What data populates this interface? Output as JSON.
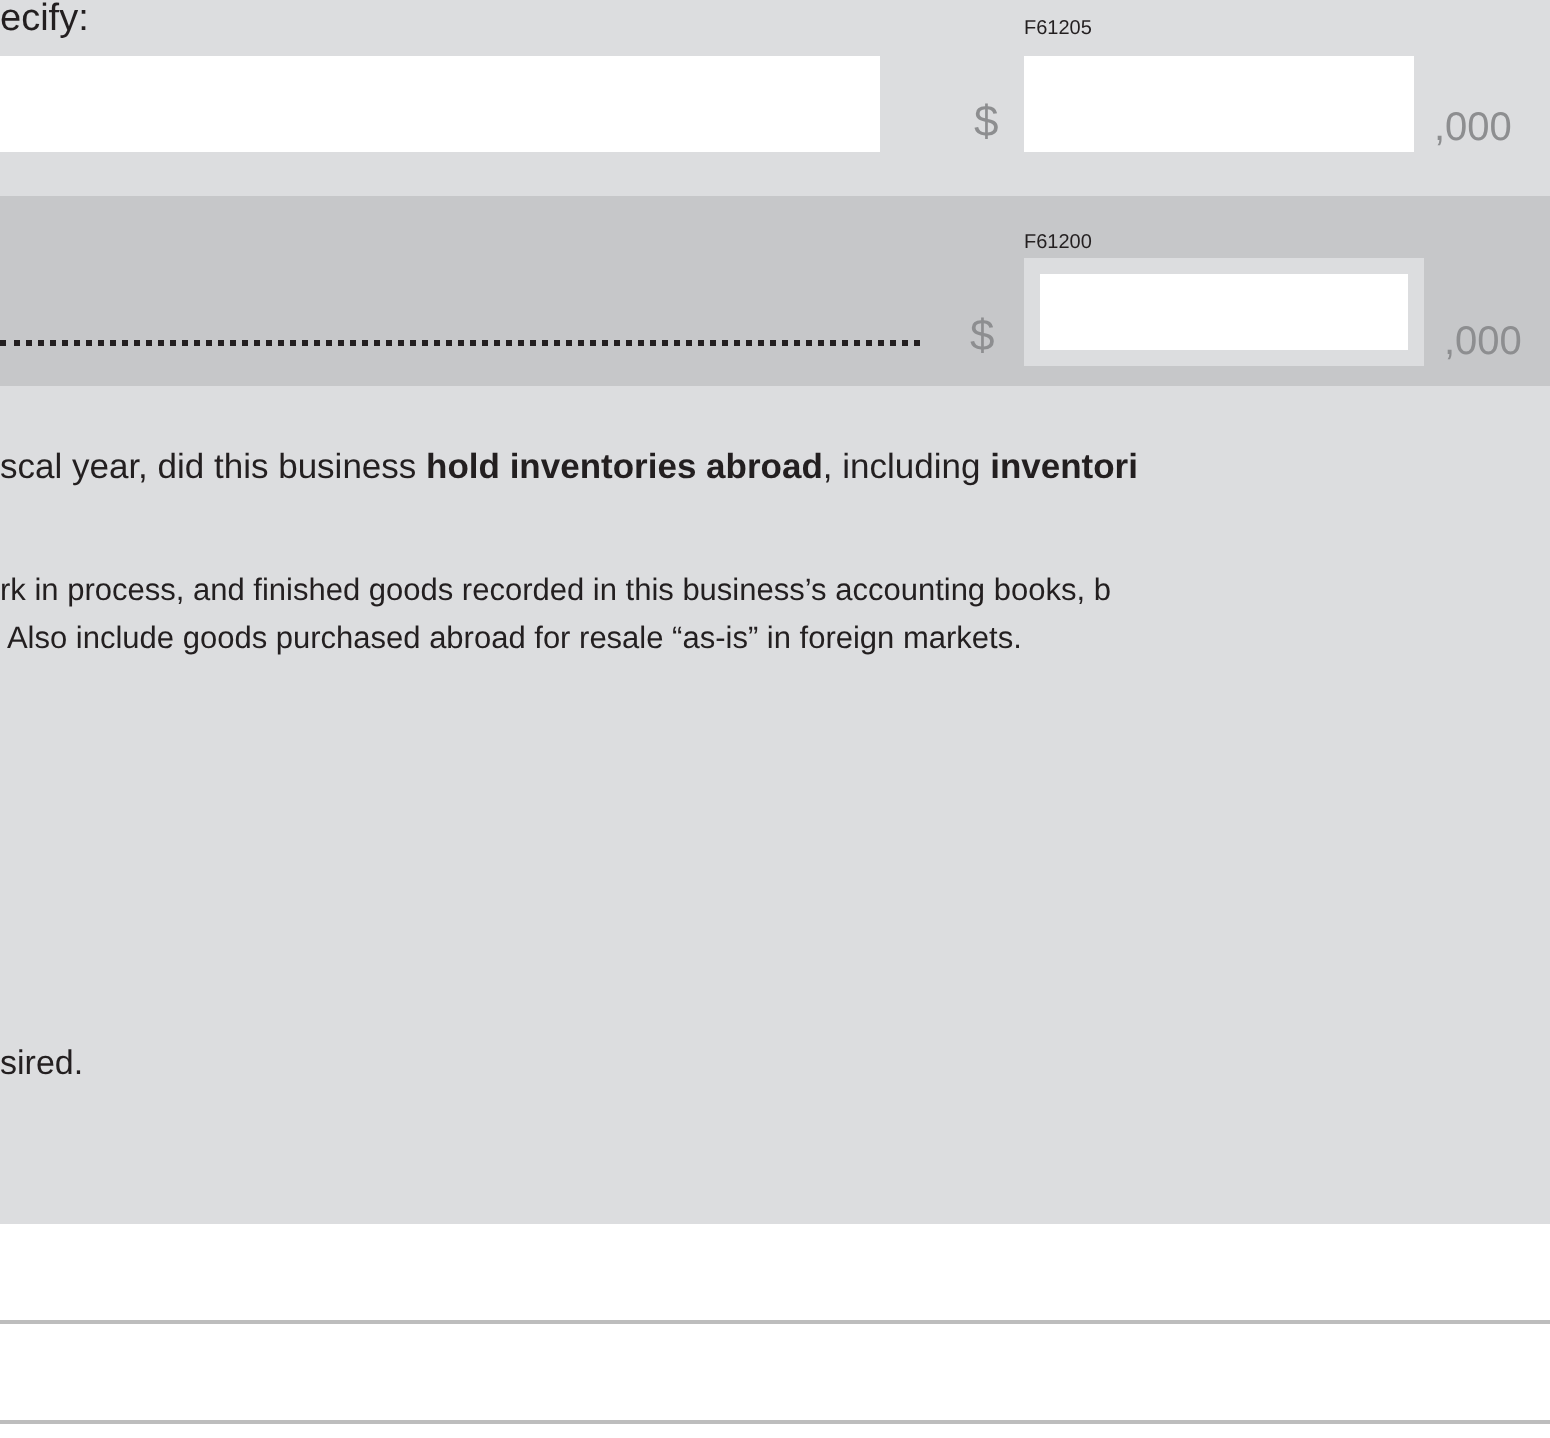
{
  "specify_row": {
    "label": "ecify:",
    "code": "F61205",
    "currency": "$",
    "suffix": ",000"
  },
  "total_row": {
    "code": "F61200",
    "currency": "$",
    "suffix": ",000"
  },
  "question": {
    "text": "scal year, did this business **hold inventories abroad**, including **inventori**",
    "note_lines": [
      "rk in process, and finished goods recorded in this business’s accounting books, b",
      " Also include goods purchased abroad for resale “as-is” in foreign markets."
    ],
    "trailing": "sired."
  }
}
